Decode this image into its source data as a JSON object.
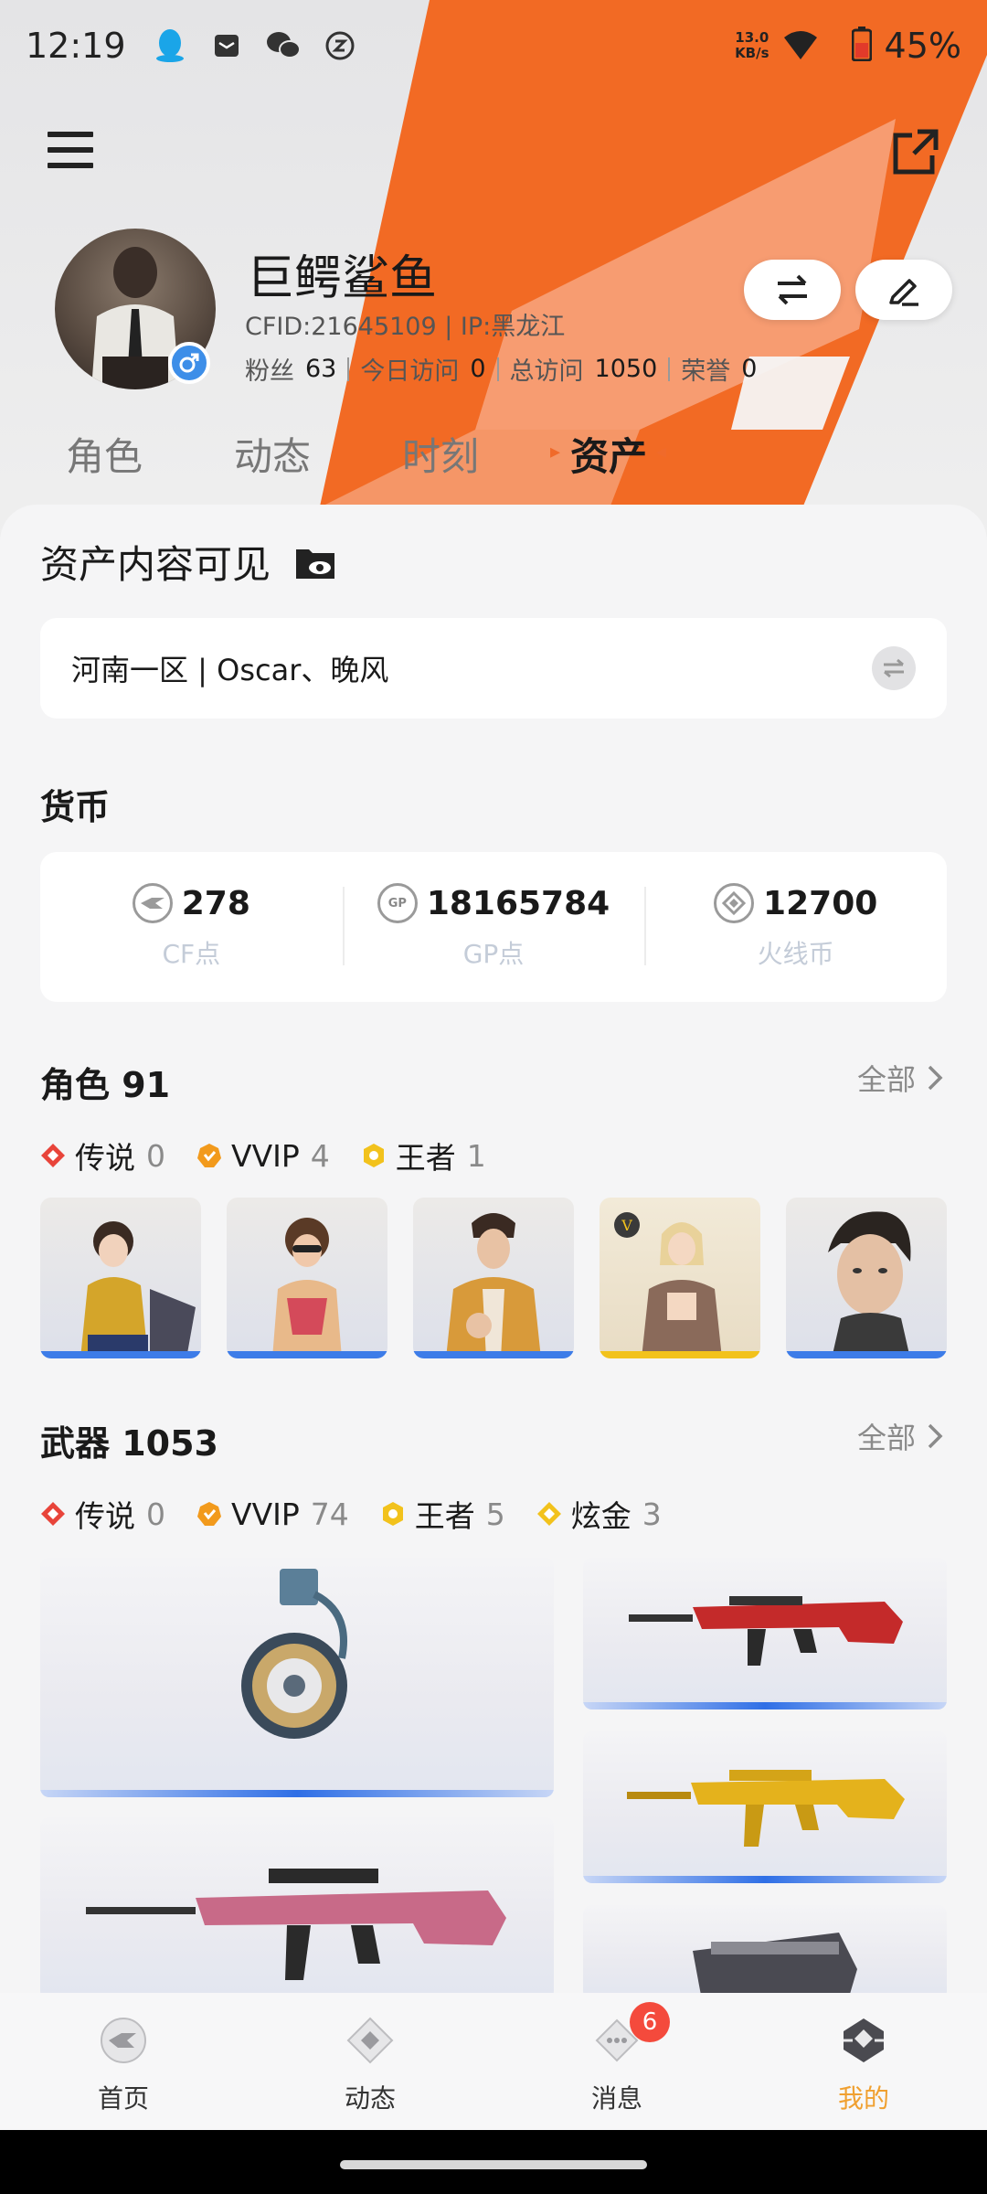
{
  "status_bar": {
    "time": "12:19",
    "net_speed_value": "13.0",
    "net_speed_unit": "KB/s",
    "battery": "45%",
    "icons": [
      "qq-icon",
      "mail-icon",
      "wechat-icon",
      "vpn-icon",
      "wifi-icon",
      "battery-icon"
    ]
  },
  "profile": {
    "nickname": "巨鳄鲨鱼",
    "cfid": "CFID:21645109 | IP:黑龙江",
    "stats": [
      {
        "label": "粉丝",
        "value": "63"
      },
      {
        "label": "今日访问",
        "value": "0"
      },
      {
        "label": "总访问",
        "value": "1050"
      },
      {
        "label": "荣誉",
        "value": "0"
      }
    ]
  },
  "tabs": [
    {
      "label": "角色",
      "active": false
    },
    {
      "label": "动态",
      "active": false
    },
    {
      "label": "时刻",
      "active": false
    },
    {
      "label": "资产",
      "active": true
    }
  ],
  "assets": {
    "visibility_title": "资产内容可见",
    "server_text": "河南一区 | Oscar、晚风"
  },
  "currency": {
    "title": "货币",
    "items": [
      {
        "icon": "cf-coin-icon",
        "value": "278",
        "label": "CF点"
      },
      {
        "icon": "gp-coin-icon",
        "value": "18165784",
        "label": "GP点",
        "badge": "GP"
      },
      {
        "icon": "fire-coin-icon",
        "value": "12700",
        "label": "火线币"
      }
    ]
  },
  "roles": {
    "title": "角色 91",
    "all_label": "全部",
    "rarities": [
      {
        "name": "传说",
        "count": "0",
        "color": "#e8443a"
      },
      {
        "name": "VVIP",
        "count": "4",
        "color": "#f29a1c"
      },
      {
        "name": "王者",
        "count": "1",
        "color": "#f2c21c"
      }
    ]
  },
  "weapons": {
    "title": "武器 1053",
    "all_label": "全部",
    "rarities": [
      {
        "name": "传说",
        "count": "0",
        "color": "#e8443a"
      },
      {
        "name": "VVIP",
        "count": "74",
        "color": "#f29a1c"
      },
      {
        "name": "王者",
        "count": "5",
        "color": "#f2c21c"
      },
      {
        "name": "炫金",
        "count": "3",
        "color": "#f2c21c"
      }
    ]
  },
  "bottom_nav": {
    "items": [
      {
        "label": "首页",
        "active": false
      },
      {
        "label": "动态",
        "active": false
      },
      {
        "label": "消息",
        "active": false,
        "badge": "6"
      },
      {
        "label": "我的",
        "active": true
      }
    ]
  },
  "colors": {
    "accent_orange": "#f26a24",
    "active_nav": "#f0a030",
    "badge_red": "#f44a3c",
    "rarity_blue_bar": "#3d7ce8"
  }
}
